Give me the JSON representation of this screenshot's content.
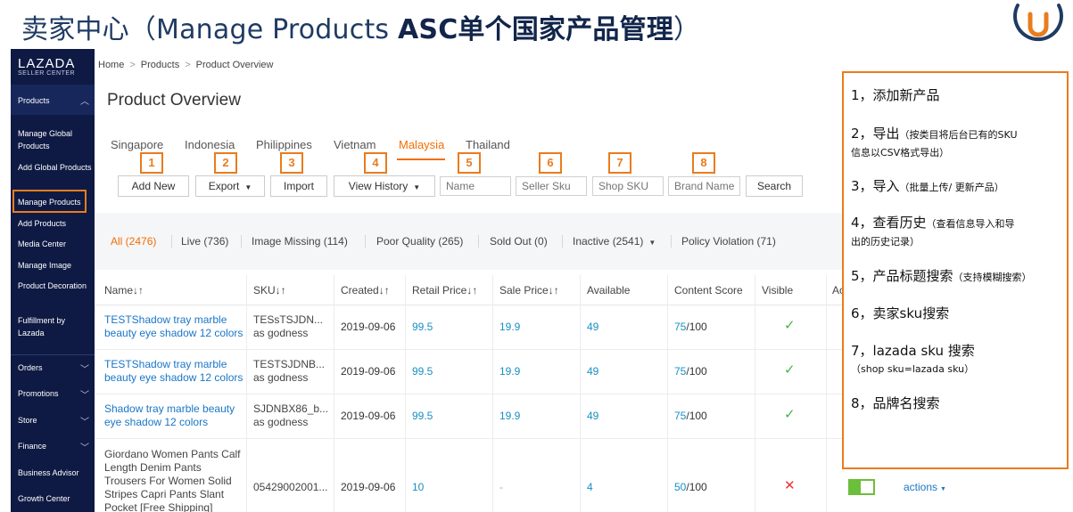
{
  "slide": {
    "title_light": "卖家中心（Manage Products ",
    "title_bold": "ASC单个国家产品管理",
    "title_end": "）"
  },
  "sidebar": {
    "brand": "LAZADA",
    "sub": "SELLER CENTER",
    "section": "Products",
    "items": [
      {
        "label": "Manage Global Products"
      },
      {
        "label": "Add Global Products"
      },
      {
        "label": "Manage Products"
      },
      {
        "label": "Add Products"
      },
      {
        "label": "Media Center"
      },
      {
        "label": "Manage Image"
      },
      {
        "label": "Product Decoration"
      },
      {
        "label": "Fulfillment by Lazada"
      }
    ],
    "menus": [
      {
        "label": "Orders"
      },
      {
        "label": "Promotions"
      },
      {
        "label": "Store"
      },
      {
        "label": "Finance"
      },
      {
        "label": "Business Advisor"
      },
      {
        "label": "Growth Center"
      }
    ]
  },
  "breadcrumb": {
    "home": "Home",
    "products": "Products",
    "current": "Product Overview",
    "sep": ">"
  },
  "page_title": "Product Overview",
  "countries": [
    "Singapore",
    "Indonesia",
    "Philippines",
    "Vietnam",
    "Malaysia",
    "Thailand"
  ],
  "numbers": [
    "1",
    "2",
    "3",
    "4",
    "5",
    "6",
    "7",
    "8"
  ],
  "toolbar": {
    "add_new": "Add New",
    "export": "Export",
    "import": "Import",
    "view_history": "View History",
    "name_ph": "Name",
    "seller_sku_ph": "Seller Sku",
    "shop_sku_ph": "Shop SKU",
    "brand_ph": "Brand Name",
    "search": "Search"
  },
  "filters": {
    "all": "All (2476)",
    "live": "Live (736)",
    "image_missing": "Image Missing (114)",
    "poor_quality": "Poor Quality (265)",
    "sold_out": "Sold Out (0)",
    "inactive": "Inactive (2541)",
    "policy": "Policy Violation (71)"
  },
  "table": {
    "headers": {
      "name": "Name↓↑",
      "sku": "SKU↓↑",
      "created": "Created↓↑",
      "retail": "Retail Price↓↑",
      "sale": "Sale Price↓↑",
      "available": "Available",
      "score": "Content Score",
      "visible": "Visible",
      "actions": "Ac"
    },
    "rows": [
      {
        "name1": "TESTShadow tray marble",
        "name2": "beauty eye shadow 12 colors",
        "sku1": "TESsTSJDN...",
        "sku2": "as godness",
        "created": "2019-09-06",
        "retail": "99.5",
        "sale": "19.9",
        "available": "49",
        "score_num": "75",
        "score_den": "/100"
      },
      {
        "name1": "TESTShadow tray marble",
        "name2": "beauty eye shadow 12 colors",
        "sku1": "TESTSJDNB...",
        "sku2": "as godness",
        "created": "2019-09-06",
        "retail": "99.5",
        "sale": "19.9",
        "available": "49",
        "score_num": "75",
        "score_den": "/100"
      },
      {
        "name1": "Shadow tray marble beauty",
        "name2": "eye shadow 12 colors",
        "sku1": "SJDNBX86_b...",
        "sku2": "as godness",
        "created": "2019-09-06",
        "retail": "99.5",
        "sale": "19.9",
        "available": "49",
        "score_num": "75",
        "score_den": "/100"
      },
      {
        "name1": "Giordano Women Pants Calf",
        "name2": "Length Denim Pants",
        "name3": "Trousers For Women Solid",
        "name4": "Stripes Capri Pants Slant",
        "name5": "Pocket [Free Shipping]",
        "sku1": "05429002001...",
        "created": "2019-09-06",
        "retail": "10",
        "sale": "-",
        "available": "4",
        "score_num": "50",
        "score_den": "/100",
        "actions": "actions"
      }
    ]
  },
  "annotations": [
    {
      "main": "1，添加新产品",
      "note": ""
    },
    {
      "main": "2，导出",
      "note": "（按类目将后台已有的SKU",
      "note2": "信息以CSV格式导出）"
    },
    {
      "main": "3，导入",
      "note": "（批量上传/ 更新产品）"
    },
    {
      "main": "4，查看历史",
      "note": "（查看信息导入和导",
      "note2": "出的历史记录）"
    },
    {
      "main": "5，产品标题搜索",
      "note": "（支持模糊搜索）"
    },
    {
      "main": "6，卖家sku搜索",
      "note": ""
    },
    {
      "main": "7，lazada sku 搜索",
      "note": "（shop sku=lazada sku）"
    },
    {
      "main": "8，品牌名搜索",
      "note": ""
    }
  ],
  "colors": {
    "accent": "#f36d00",
    "annotation": "#e97c1e",
    "sidebar": "#0f1a44",
    "link": "#1a76c7"
  }
}
